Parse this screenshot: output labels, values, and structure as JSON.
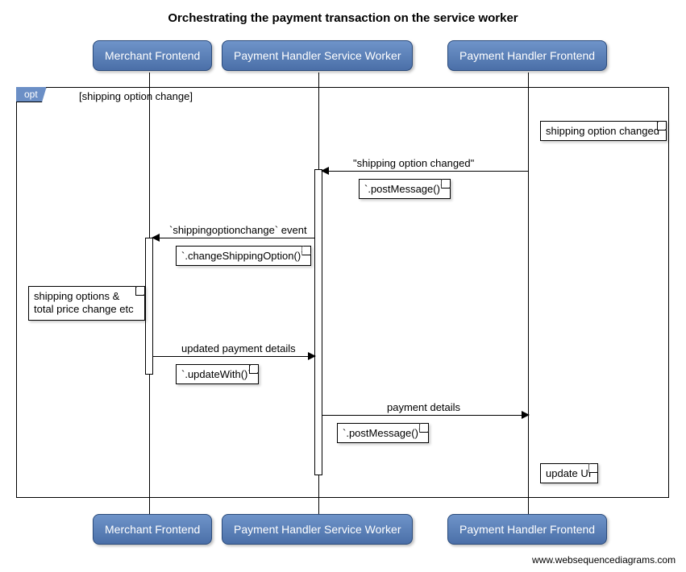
{
  "title": "Orchestrating the payment transaction on the service worker",
  "participants": {
    "p1": "Merchant Frontend",
    "p2": "Payment Handler Service Worker",
    "p3": "Payment Handler Frontend"
  },
  "opt": {
    "tag": "opt",
    "label": "[shipping option change]"
  },
  "notes": {
    "n1": "shipping option changed",
    "n2": "shipping options & total price change etc",
    "n3": "update UI"
  },
  "messages": {
    "m1": {
      "label": "\"shipping option changed\"",
      "sub": "`.postMessage()`"
    },
    "m2": {
      "label": "`shippingoptionchange` event",
      "sub": "`.changeShippingOption()`"
    },
    "m3": {
      "label": "updated payment details",
      "sub": "`.updateWith()`"
    },
    "m4": {
      "label": "payment details",
      "sub": "`.postMessage()`"
    }
  },
  "attribution": "www.websequencediagrams.com",
  "chart_data": {
    "type": "sequence-diagram",
    "title": "Orchestrating the payment transaction on the service worker",
    "participants": [
      "Merchant Frontend",
      "Payment Handler Service Worker",
      "Payment Handler Frontend"
    ],
    "fragments": [
      {
        "type": "opt",
        "guard": "shipping option change",
        "steps": [
          {
            "kind": "note",
            "on": "Payment Handler Frontend",
            "text": "shipping option changed"
          },
          {
            "kind": "message",
            "from": "Payment Handler Frontend",
            "to": "Payment Handler Service Worker",
            "label": "\"shipping option changed\"",
            "mechanism": ".postMessage()"
          },
          {
            "kind": "message",
            "from": "Payment Handler Service Worker",
            "to": "Merchant Frontend",
            "label": "shippingoptionchange event",
            "mechanism": ".changeShippingOption()"
          },
          {
            "kind": "note",
            "on": "Merchant Frontend",
            "text": "shipping options & total price change etc"
          },
          {
            "kind": "message",
            "from": "Merchant Frontend",
            "to": "Payment Handler Service Worker",
            "label": "updated payment details",
            "mechanism": ".updateWith()"
          },
          {
            "kind": "message",
            "from": "Payment Handler Service Worker",
            "to": "Payment Handler Frontend",
            "label": "payment details",
            "mechanism": ".postMessage()"
          },
          {
            "kind": "note",
            "on": "Payment Handler Frontend",
            "text": "update UI"
          }
        ]
      }
    ]
  }
}
